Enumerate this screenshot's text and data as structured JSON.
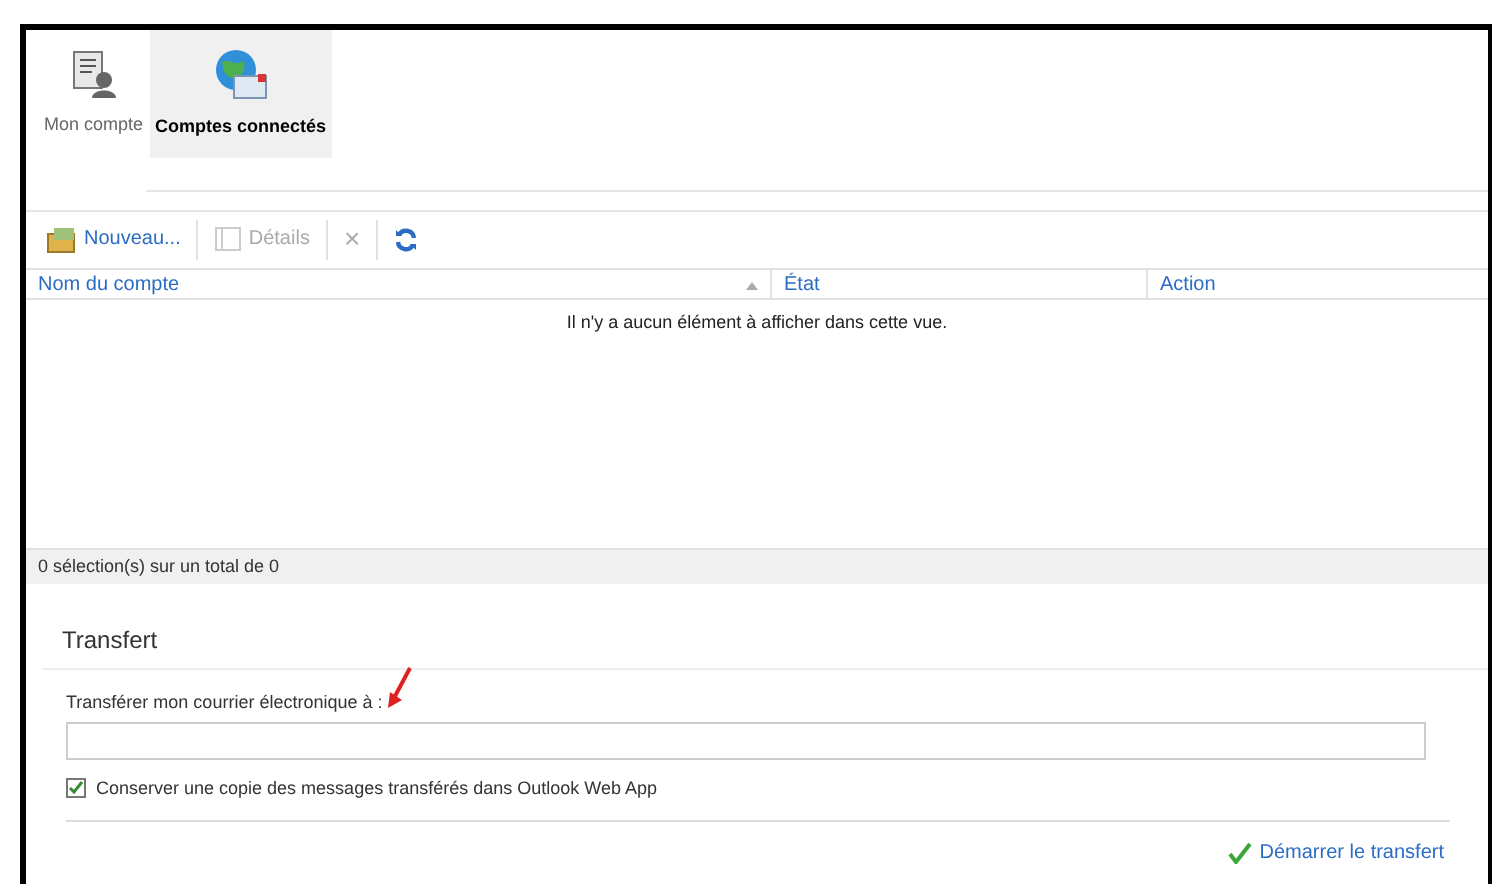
{
  "tabs": [
    {
      "label": "Mon compte",
      "selected": false,
      "kind": "account"
    },
    {
      "label": "Comptes connectés",
      "selected": true,
      "kind": "globe"
    }
  ],
  "toolbar": [
    {
      "kind": "new",
      "label": "Nouveau...",
      "disabled": false
    },
    {
      "kind": "details",
      "label": "Détails",
      "disabled": true
    },
    {
      "kind": "delete",
      "label": "×",
      "disabled": true
    },
    {
      "kind": "refresh",
      "disabled": false
    }
  ],
  "table": {
    "columns": [
      {
        "label": "Nom du compte",
        "sorted": true
      },
      {
        "label": "État",
        "sorted": false
      },
      {
        "label": "Action",
        "sorted": false
      }
    ],
    "empty_message": "Il n'y a aucun élément à afficher dans cette vue."
  },
  "status_bar": "0 sélection(s) sur un total de 0",
  "transfer": {
    "title": "Transfert",
    "field_label": "Transférer mon courrier électronique à :",
    "keep_copy": {
      "label": "Conserver une copie des messages transférés dans Outlook Web App",
      "checked": true
    },
    "start_button": "Démarrer le transfert"
  }
}
